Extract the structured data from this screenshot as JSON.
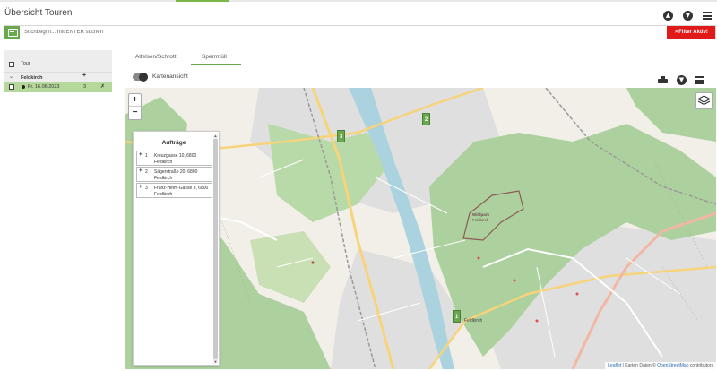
{
  "header": {
    "title": "Übersicht Touren",
    "icons": [
      "arrow-up-circle-icon",
      "arrow-down-circle-icon",
      "menu-icon"
    ]
  },
  "search": {
    "placeholder": "Suchbegriff... mit ENTER suchen",
    "value": "",
    "filter_label": "✕Filter Aktiv!"
  },
  "left_panel": {
    "header_label": "Tour",
    "group": {
      "name": "Feldkirch",
      "add_symbol": "+"
    },
    "rows": [
      {
        "date": "Fr. 16.06.2023",
        "count": "3",
        "action": "✗"
      }
    ]
  },
  "tabs": [
    {
      "label": "Altelsen/Schrott",
      "active": false
    },
    {
      "label": "Sperrmüll",
      "active": true
    }
  ],
  "view": {
    "toggle_label": "Kartenansicht",
    "toggle_on": true
  },
  "map": {
    "zoom_in": "+",
    "zoom_out": "−",
    "markers": [
      "2",
      "3",
      "1"
    ],
    "park_label_1": "Wildpark",
    "park_label_2": "Feldkirch",
    "town_label": "Feldkirch",
    "attribution": {
      "leaflet": "Leaflet",
      "sep": " | Karten Daten © ",
      "osm": "OpenStreetMap",
      "rest": " contributors"
    },
    "colors": {
      "marker": "#6aa84f",
      "forest": "#add19e",
      "road": "#f7d37a",
      "rail": "#999999",
      "river": "#aad3df"
    }
  },
  "orders": {
    "title": "Aufträge",
    "items": [
      {
        "plus": "+",
        "num": "1",
        "address": "Kreuzgasse 10, 6800 Feldkirch"
      },
      {
        "plus": "+",
        "num": "2",
        "address": "Sägerstraße 20, 6800 Feldkirch"
      },
      {
        "plus": "+",
        "num": "3",
        "address": "Franz-Heim-Gasse 3, 6800 Feldkirch"
      }
    ]
  }
}
